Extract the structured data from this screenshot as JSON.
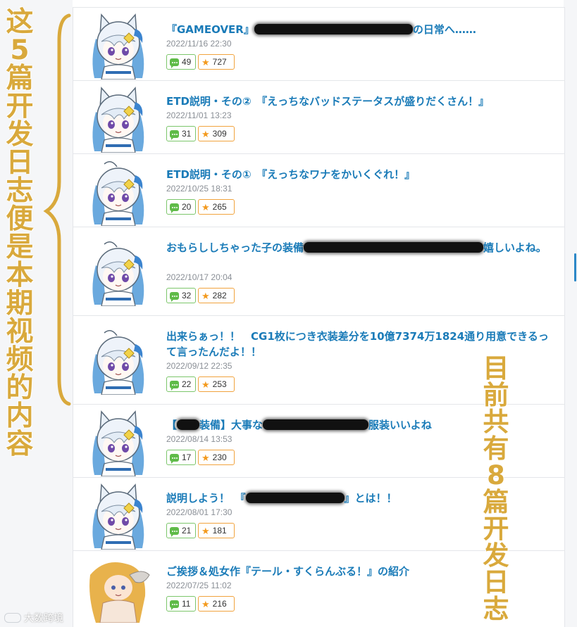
{
  "posts": [
    {
      "title_before": "『GAMEOVER』",
      "title_after": "の日常へ……",
      "date": "2022/11/16 22:30",
      "comments": "49",
      "favorites": "727",
      "thumb": "cat-girl-chibi"
    },
    {
      "title_before": "ETD説明・その②　『えっちなバッドステータスが盛りだくさん！』",
      "title_after": "",
      "date": "2022/11/01 13:23",
      "comments": "31",
      "favorites": "309",
      "thumb": "cat-girl-chibi"
    },
    {
      "title_before": "ETD説明・その①　『えっちなワナをかいくぐれ！』",
      "title_after": "",
      "date": "2022/10/25 18:31",
      "comments": "20",
      "favorites": "265",
      "thumb": "girl-chibi"
    },
    {
      "title_before": "おもらししちゃった子の装備",
      "title_after": "嬉しいよね。",
      "date": "2022/10/17 20:04",
      "comments": "32",
      "favorites": "282",
      "thumb": "girl-chibi"
    },
    {
      "title_before": "出来らぁっ！！　CG1枚につき衣装差分を10億7374万1824通り用意できるって言ったんだよ！！",
      "title_after": "",
      "date": "2022/09/12 22:35",
      "comments": "22",
      "favorites": "253",
      "thumb": "girl-chibi"
    },
    {
      "title_before": "【",
      "title_mid": "装備】大事な",
      "title_after": "服装いいよね",
      "date": "2022/08/14 13:53",
      "comments": "17",
      "favorites": "230",
      "thumb": "cat-girl-chibi"
    },
    {
      "title_before": "説明しよう！　『",
      "title_after": "』とは！！",
      "date": "2022/08/01 17:30",
      "comments": "21",
      "favorites": "181",
      "thumb": "cat-girl-chibi"
    },
    {
      "title_before": "ご挨拶＆処女作『テール・すくらんぶる！』の紹介",
      "title_after": "",
      "date": "2022/07/25 11:02",
      "comments": "11",
      "favorites": "216",
      "thumb": "blonde-girl"
    }
  ],
  "annotations": {
    "left": "这5篇开发日志便是本期视频的内容",
    "right": "目前共有8篇开发日志"
  },
  "watermark": "大数跨境",
  "colors": {
    "title": "#1a7bb8",
    "comment_border": "#7cc66b",
    "favorite_border": "#f1a33d",
    "annotation": "#d9a93c"
  }
}
